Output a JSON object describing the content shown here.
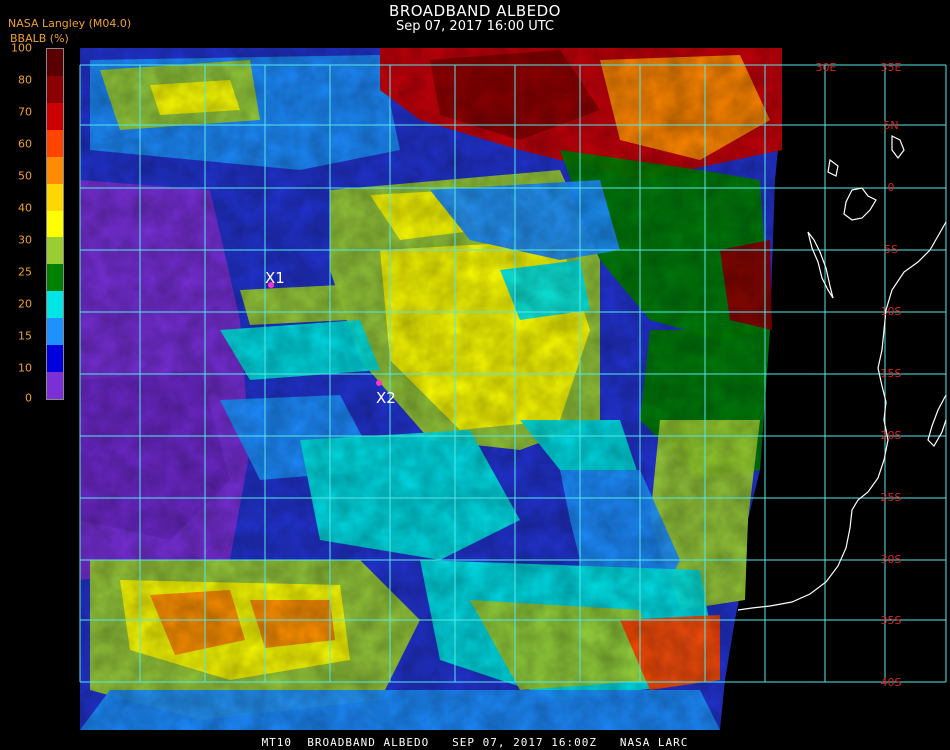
{
  "header": {
    "title": "BROADBAND ALBEDO",
    "datetime": "Sep 07, 2017 16:00 UTC",
    "source": "NASA Langley (M04.0)",
    "colorbar_label": "BBALB (%)"
  },
  "colorbar": {
    "ticks": [
      "100",
      "80",
      "70",
      "60",
      "50",
      "40",
      "30",
      "25",
      "20",
      "15",
      "10",
      "0"
    ],
    "colors": [
      "#5a0000",
      "#8b0000",
      "#cc0000",
      "#ff4400",
      "#ff8c00",
      "#ffd700",
      "#ffff00",
      "#9acd32",
      "#008000",
      "#00e5e5",
      "#1e90ff",
      "#0000dd",
      "#7b2fd6"
    ]
  },
  "map": {
    "lon_labels": [
      "30E",
      "35E"
    ],
    "lat_labels": [
      "5N",
      "0",
      "5S",
      "10S",
      "15S",
      "20S",
      "25S",
      "30S",
      "35S",
      "40S"
    ],
    "markers": [
      {
        "label": "X1"
      },
      {
        "label": "X2"
      }
    ]
  },
  "footer": "MT10  BROADBAND ALBEDO   SEP 07, 2017 16:00Z   NASA LARC"
}
